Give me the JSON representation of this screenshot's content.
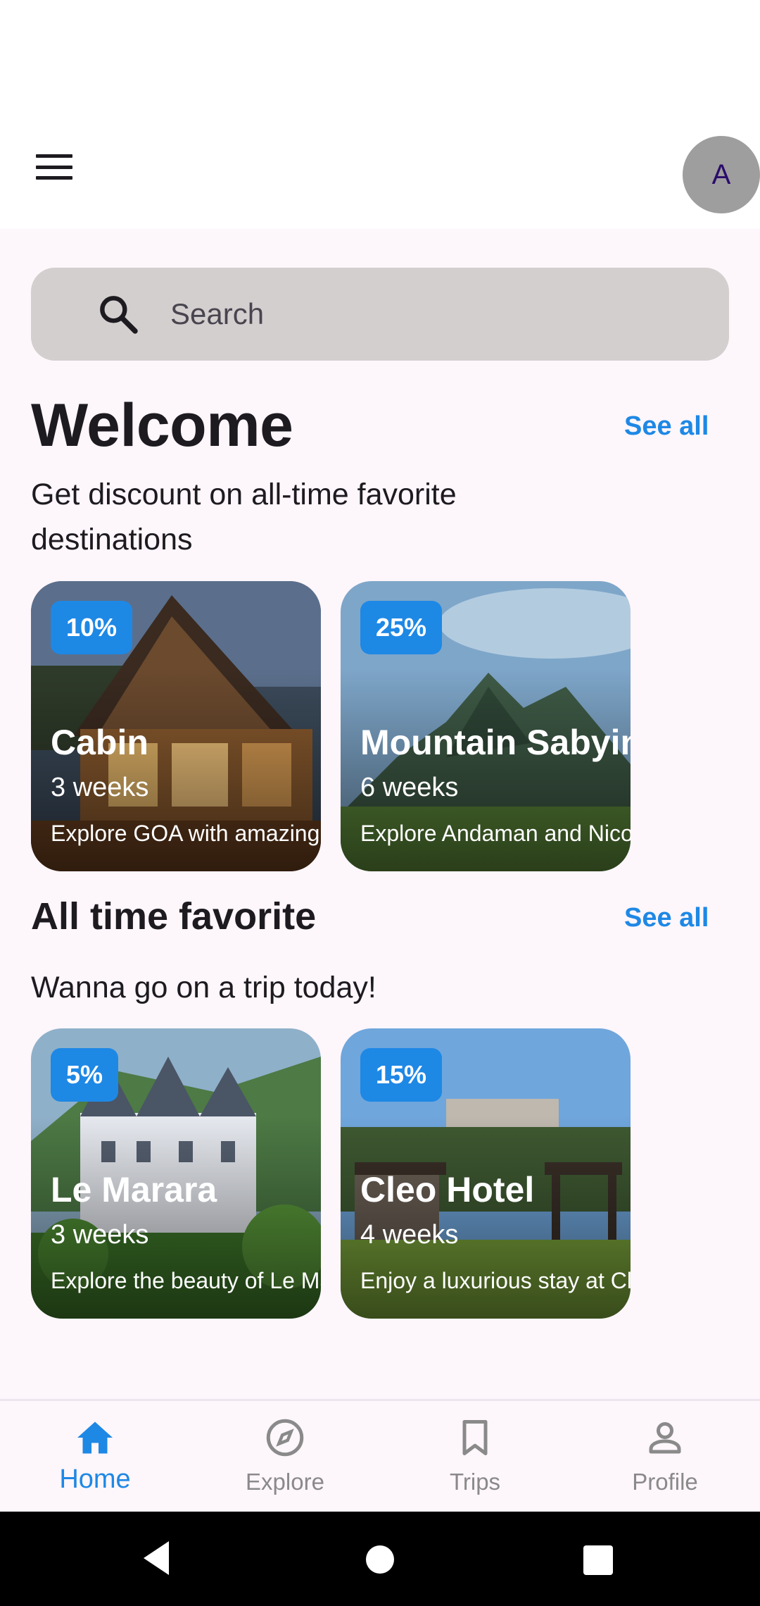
{
  "header": {
    "avatar_letter": "A"
  },
  "search": {
    "placeholder": "Search"
  },
  "welcome": {
    "title": "Welcome",
    "see_all": "See all",
    "subtitle_line1": "Get discount on all-time favorite",
    "subtitle_line2": "destinations",
    "cards": [
      {
        "discount": "10%",
        "title": "Cabin",
        "duration": "3 weeks",
        "description": "Explore GOA with amazing"
      },
      {
        "discount": "25%",
        "title": "Mountain Sabyinyo",
        "duration": "6 weeks",
        "description": "Explore Andaman and Nicobar"
      }
    ]
  },
  "favorites": {
    "title": "All time favorite",
    "see_all": "See all",
    "subtitle": "Wanna go on a trip today!",
    "cards": [
      {
        "discount": "5%",
        "title": "Le Marara",
        "duration": "3 weeks",
        "description": "Explore the beauty of Le Marara"
      },
      {
        "discount": "15%",
        "title": "Cleo Hotel",
        "duration": "4 weeks",
        "description": "Enjoy a luxurious stay at Cleo"
      }
    ]
  },
  "bottom_nav": {
    "items": [
      {
        "label": "Home",
        "icon": "home-icon",
        "active": true
      },
      {
        "label": "Explore",
        "icon": "compass-icon",
        "active": false
      },
      {
        "label": "Trips",
        "icon": "bookmark-icon",
        "active": false
      },
      {
        "label": "Profile",
        "icon": "person-icon",
        "active": false
      }
    ]
  },
  "colors": {
    "accent": "#1e88e5",
    "background": "#fdf6fb",
    "search_bg": "#d3cfcf",
    "avatar_bg": "#9e9e9e"
  }
}
